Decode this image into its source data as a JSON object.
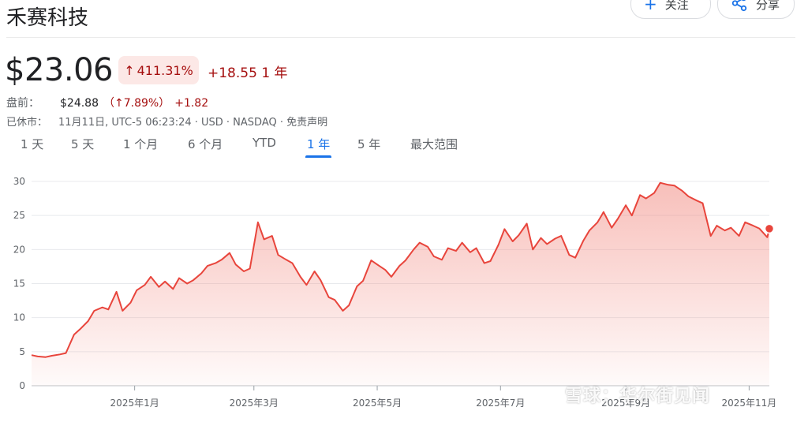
{
  "header": {
    "title": "禾赛科技",
    "follow_label": "关注",
    "share_label": "分享"
  },
  "quote": {
    "price": "$23.06",
    "change_pct": "411.31%",
    "change_abs": "+18.55 1 年",
    "premarket_label": "盘前：",
    "premarket_price": "$24.88",
    "premarket_pct": "（↑7.89%）",
    "premarket_abs": "+1.82",
    "status_label": "已休市：",
    "status_text": "11月11日, UTC-5 06:23:24 · USD · NASDAQ · 免责声明"
  },
  "tabs": [
    {
      "label": "1 天"
    },
    {
      "label": "5 天"
    },
    {
      "label": "1 个月"
    },
    {
      "label": "6 个月"
    },
    {
      "label": "YTD"
    },
    {
      "label": "1 年",
      "active": true
    },
    {
      "label": "5 年"
    },
    {
      "label": "最大范围"
    }
  ],
  "icons": {
    "follow": "plus-icon",
    "share": "share-icon",
    "up_arrow": "arrow-up-icon"
  },
  "colors": {
    "line": "#e8453c",
    "fill_top": "#f28b82",
    "accent_blue": "#1a73e8",
    "negative_text": "#a50e0e",
    "badge_bg": "#fce8e6"
  },
  "watermark": "雪球：华尔街见闻",
  "chart_data": {
    "type": "area",
    "yticks": [
      0,
      5,
      10,
      15,
      20,
      25,
      30
    ],
    "ylim": [
      0,
      30
    ],
    "xlim": [
      "2024-11-11",
      "2025-11-11"
    ],
    "xticks": [
      {
        "date": "2025-01-01",
        "label": "2025年1月"
      },
      {
        "date": "2025-03-01",
        "label": "2025年3月"
      },
      {
        "date": "2025-05-01",
        "label": "2025年5月"
      },
      {
        "date": "2025-07-01",
        "label": "2025年7月"
      },
      {
        "date": "2025-09-01",
        "label": "2025年9月"
      },
      {
        "date": "2025-11-01",
        "label": "2025年11月"
      }
    ],
    "grid": true,
    "last_point_marker": true,
    "series": [
      {
        "x": [
          "2024-11-11",
          "2024-11-14",
          "2024-11-18",
          "2024-11-21",
          "2024-11-25",
          "2024-11-28",
          "2024-12-02",
          "2024-12-05",
          "2024-12-09",
          "2024-12-12",
          "2024-12-16",
          "2024-12-19",
          "2024-12-23",
          "2024-12-26",
          "2024-12-30",
          "2025-01-02",
          "2025-01-06",
          "2025-01-09",
          "2025-01-13",
          "2025-01-16",
          "2025-01-20",
          "2025-01-23",
          "2025-01-27",
          "2025-01-30",
          "2025-02-03",
          "2025-02-06",
          "2025-02-10",
          "2025-02-13",
          "2025-02-17",
          "2025-02-20",
          "2025-02-24",
          "2025-02-27",
          "2025-03-03",
          "2025-03-06",
          "2025-03-10",
          "2025-03-13",
          "2025-03-17",
          "2025-03-20",
          "2025-03-24",
          "2025-03-27",
          "2025-03-31",
          "2025-04-03",
          "2025-04-07",
          "2025-04-10",
          "2025-04-14",
          "2025-04-17",
          "2025-04-21",
          "2025-04-24",
          "2025-04-28",
          "2025-05-01",
          "2025-05-05",
          "2025-05-08",
          "2025-05-12",
          "2025-05-15",
          "2025-05-19",
          "2025-05-22",
          "2025-05-26",
          "2025-05-29",
          "2025-06-02",
          "2025-06-05",
          "2025-06-09",
          "2025-06-12",
          "2025-06-16",
          "2025-06-19",
          "2025-06-23",
          "2025-06-26",
          "2025-06-30",
          "2025-07-03",
          "2025-07-07",
          "2025-07-10",
          "2025-07-14",
          "2025-07-17",
          "2025-07-21",
          "2025-07-24",
          "2025-07-28",
          "2025-07-31",
          "2025-08-04",
          "2025-08-07",
          "2025-08-11",
          "2025-08-14",
          "2025-08-18",
          "2025-08-21",
          "2025-08-25",
          "2025-08-28",
          "2025-09-01",
          "2025-09-04",
          "2025-09-08",
          "2025-09-11",
          "2025-09-15",
          "2025-09-18",
          "2025-09-22",
          "2025-09-25",
          "2025-09-29",
          "2025-10-02",
          "2025-10-06",
          "2025-10-09",
          "2025-10-13",
          "2025-10-16",
          "2025-10-20",
          "2025-10-23",
          "2025-10-27",
          "2025-10-30",
          "2025-11-03",
          "2025-11-06",
          "2025-11-10",
          "2025-11-11"
        ],
        "y": [
          4.5,
          4.3,
          4.2,
          4.4,
          4.6,
          4.8,
          7.5,
          8.3,
          9.5,
          11.0,
          11.5,
          11.2,
          13.8,
          11.0,
          12.2,
          14.0,
          14.8,
          16.0,
          14.5,
          15.3,
          14.2,
          15.8,
          15.0,
          15.5,
          16.5,
          17.6,
          18.0,
          18.5,
          19.5,
          17.8,
          16.8,
          17.2,
          24.0,
          21.5,
          22.0,
          19.2,
          18.5,
          18.0,
          16.0,
          14.8,
          16.8,
          15.5,
          13.0,
          12.6,
          11.0,
          11.8,
          14.6,
          15.4,
          18.4,
          17.8,
          17.0,
          16.0,
          17.6,
          18.4,
          20.0,
          21.0,
          20.4,
          19.0,
          18.5,
          20.2,
          19.8,
          21.0,
          19.6,
          20.2,
          18.0,
          18.3,
          20.7,
          23.0,
          21.2,
          22.1,
          23.8,
          20.0,
          21.7,
          20.8,
          21.6,
          22.0,
          19.2,
          18.8,
          21.3,
          22.8,
          24.0,
          25.5,
          23.2,
          24.5,
          26.5,
          25.0,
          28.0,
          27.5,
          28.3,
          29.8,
          29.5,
          29.4,
          28.6,
          27.8,
          27.2,
          26.8,
          22.0,
          23.5,
          22.8,
          23.2,
          22.0,
          24.0,
          23.5,
          23.1,
          21.8,
          23.06
        ]
      }
    ]
  }
}
